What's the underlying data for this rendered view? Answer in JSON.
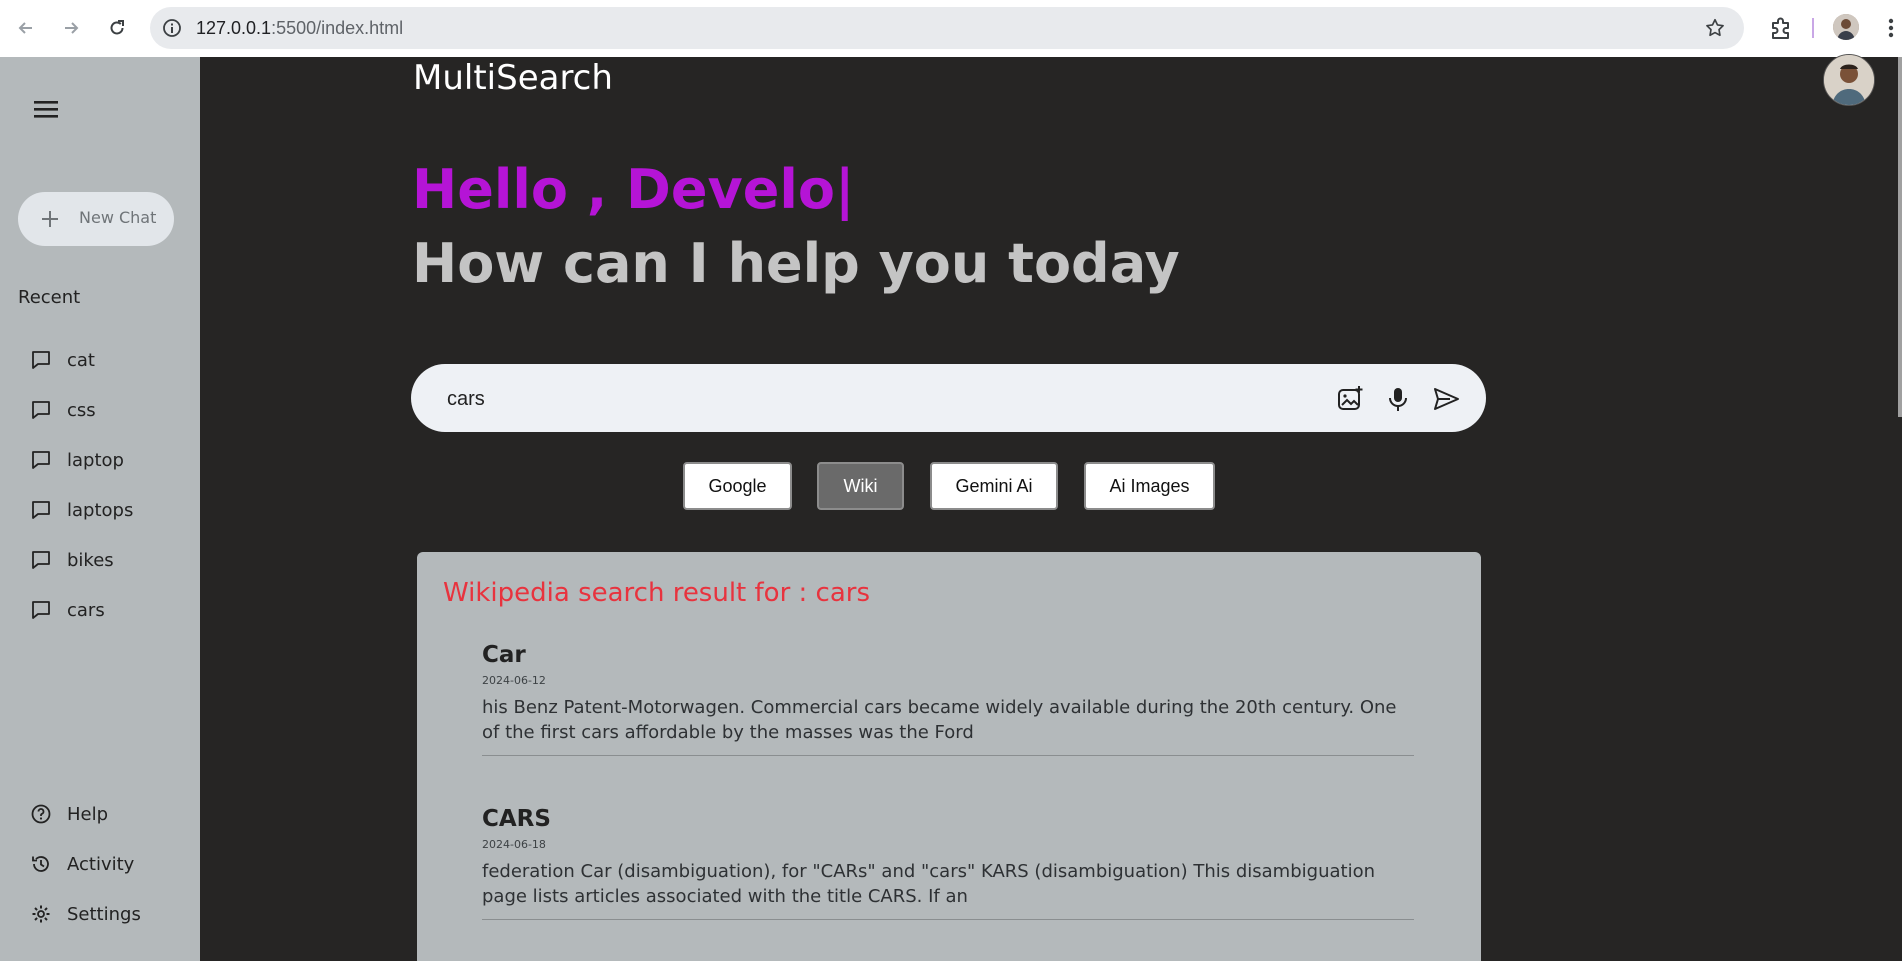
{
  "browser": {
    "url_host": "127.0.0.1",
    "url_path": ":5500/index.html"
  },
  "sidebar": {
    "new_chat_label": "New Chat",
    "recent_title": "Recent",
    "recent_items": [
      "cat",
      "css",
      "laptop",
      "laptops",
      "bikes",
      "cars"
    ],
    "bottom_items": [
      "Help",
      "Activity",
      "Settings"
    ]
  },
  "main": {
    "brand": "MultiSearch",
    "greeting": "Hello , Develo|",
    "subtitle": "How can I help you today",
    "search_value": "cars",
    "filters": [
      "Google",
      "Wiki",
      "Gemini Ai",
      "Ai Images"
    ],
    "active_filter": "Wiki"
  },
  "results": {
    "title": "Wikipedia search result for : cars",
    "items": [
      {
        "title": "Car",
        "date": "2024-06-12",
        "snippet": "his Benz Patent-Motorwagen. Commercial cars became widely available during the 20th century. One of the first cars affordable by the masses was the Ford"
      },
      {
        "title": "CARS",
        "date": "2024-06-18",
        "snippet": "federation Car (disambiguation), for \"CARs\" and \"cars\" KARS (disambiguation) This disambiguation page lists articles associated with the title CARS. If an"
      }
    ]
  },
  "colors": {
    "greeting": "#b514d6",
    "results_title": "#e8333e",
    "sidebar_bg": "#b4b9bb",
    "main_bg": "#262524"
  }
}
